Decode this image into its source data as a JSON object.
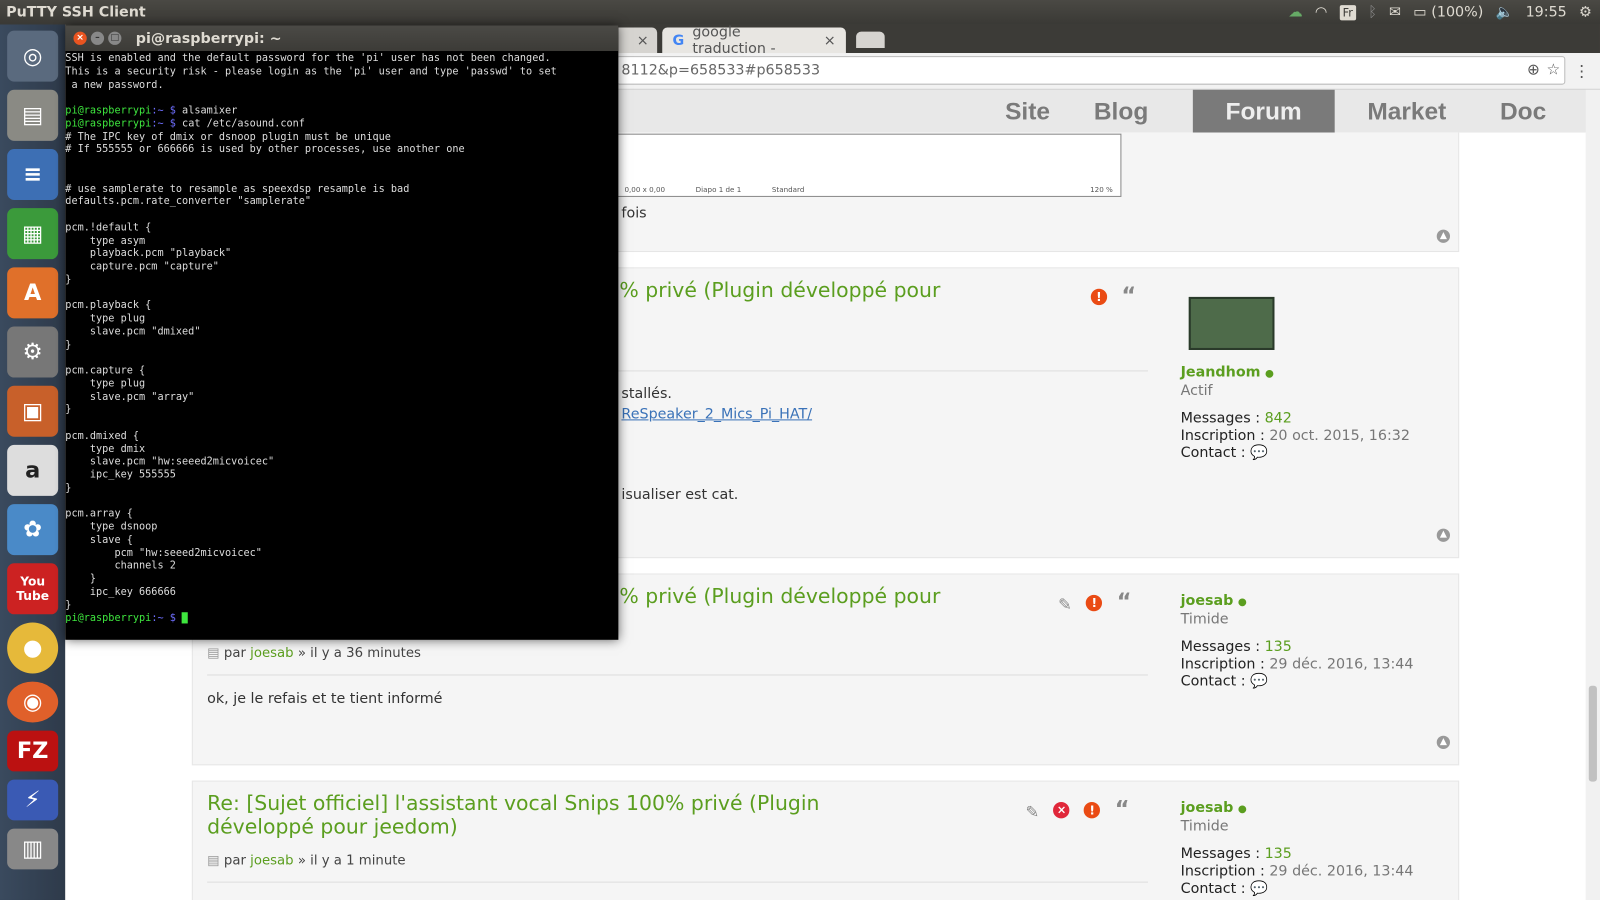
{
  "topbar": {
    "app_title": "PuTTY SSH Client",
    "keyboard": "Fr",
    "battery": "(100%)",
    "time": "19:55"
  },
  "launcher": [
    "ubuntu-dash",
    "files",
    "writer",
    "calc",
    "software-center",
    "system-settings",
    "impress",
    "amazon",
    "playonlinux",
    "youtube",
    "chrome",
    "firefox",
    "filezilla",
    "remote-desktop",
    "workspaces"
  ],
  "launcher_labels": {
    "amazon": "a",
    "youtube": "You Tube",
    "filezilla": "FZ"
  },
  "browser": {
    "tabs": [
      {
        "label": "google traduction -"
      }
    ],
    "url": "8112&p=658533#p658533",
    "nav": [
      "Site",
      "Blog",
      "Forum",
      "Market",
      "Doc"
    ],
    "nav_active": "Forum",
    "preview": {
      "status": "0,00 x 0,00",
      "slide": "Diapo 1 de 1",
      "layout": "Standard",
      "zoom": "120 %"
    },
    "posts": [
      {
        "partial_text": "fois"
      },
      {
        "title": "% privé (Plugin développé pour",
        "lines": [
          "stallés.",
          "ReSpeaker_2_Mics_Pi_HAT/",
          "isualiser est cat."
        ],
        "user": {
          "name": "Jeandhom",
          "rank": "Actif",
          "messages_label": "Messages :",
          "messages": "842",
          "inscription_label": "Inscription :",
          "inscription": "20 oct. 2015, 16:32",
          "contact_label": "Contact :"
        }
      },
      {
        "title": "% privé (Plugin développé pour",
        "by": "par",
        "author": "joesab",
        "when": "» il y a 36 minutes",
        "body": "ok, je le refais et te tient informé",
        "user": {
          "name": "joesab",
          "rank": "Timide",
          "messages_label": "Messages :",
          "messages": "135",
          "inscription_label": "Inscription :",
          "inscription": "29 déc. 2016, 13:44",
          "contact_label": "Contact :"
        }
      },
      {
        "title": "Re: [Sujet officiel] l'assistant vocal Snips 100% privé (Plugin développé pour jeedom)",
        "by": "par",
        "author": "joesab",
        "when": "» il y a 1 minute",
        "user": {
          "name": "joesab",
          "rank": "Timide",
          "messages_label": "Messages :",
          "messages": "135",
          "inscription_label": "Inscription :",
          "inscription": "29 déc. 2016, 13:44",
          "contact_label": "Contact :"
        }
      }
    ]
  },
  "terminal": {
    "title": "pi@raspberrypi: ~",
    "motd": "SSH is enabled and the default password for the 'pi' user has not been changed.\nThis is a security risk - please login as the 'pi' user and type 'passwd' to set\n a new password.\n",
    "prompt_user": "pi@raspberrypi",
    "prompt_path": ":~",
    "prompt_sym": " $ ",
    "cmd1": "alsamixer",
    "cmd2": "cat /etc/asound.conf",
    "output": "# The IPC key of dmix or dsnoop plugin must be unique\n# If 555555 or 666666 is used by other processes, use another one\n\n\n# use samplerate to resample as speexdsp resample is bad\ndefaults.pcm.rate_converter \"samplerate\"\n\npcm.!default {\n    type asym\n    playback.pcm \"playback\"\n    capture.pcm \"capture\"\n}\n\npcm.playback {\n    type plug\n    slave.pcm \"dmixed\"\n}\n\npcm.capture {\n    type plug\n    slave.pcm \"array\"\n}\n\npcm.dmixed {\n    type dmix\n    slave.pcm \"hw:seeed2micvoicec\"\n    ipc_key 555555\n}\n\npcm.array {\n    type dsnoop\n    slave {\n        pcm \"hw:seeed2micvoicec\"\n        channels 2\n    }\n    ipc_key 666666\n}\n"
  },
  "colors": {
    "accent_green": "#5b9e1f",
    "terminal_prompt": "#3ee63e",
    "active_nav": "#7a7a7a",
    "warn": "#ea4b14"
  }
}
